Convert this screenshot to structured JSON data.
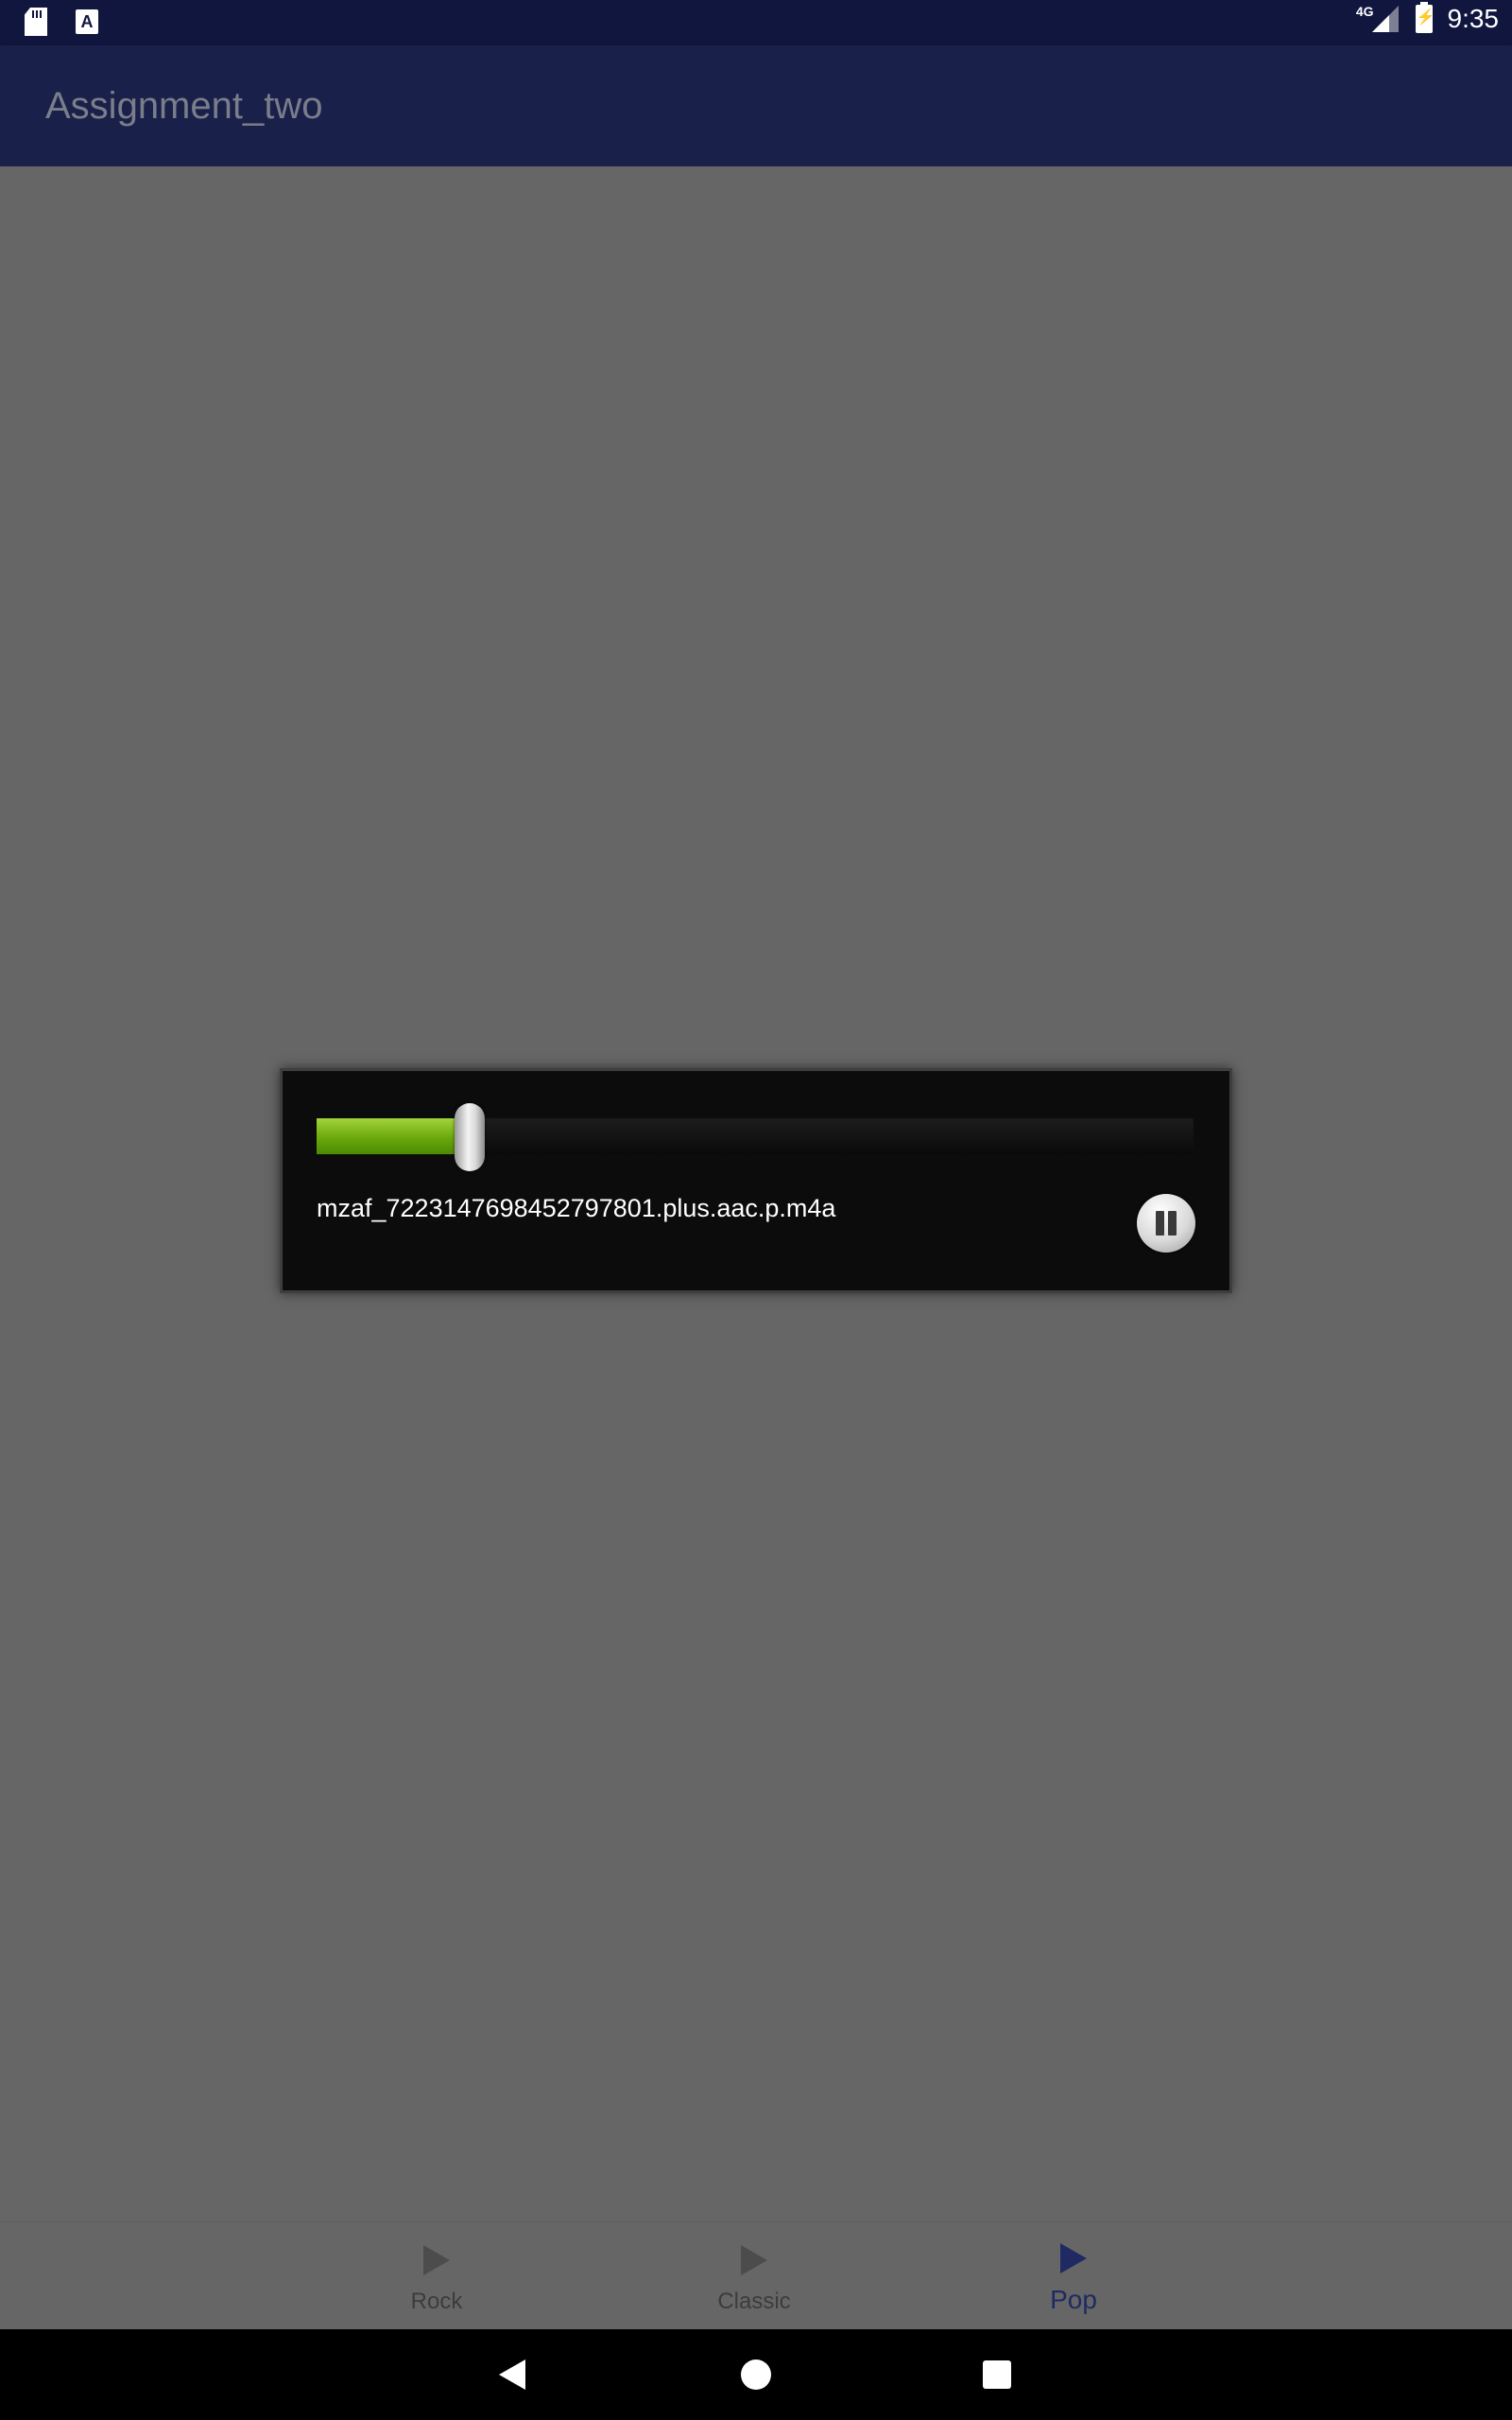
{
  "status_bar": {
    "network_type": "4G",
    "time": "9:35",
    "icons": [
      "sd-card-icon",
      "a-notification-icon",
      "signal-icon",
      "battery-charging-icon"
    ]
  },
  "app_bar": {
    "title": "Assignment_two"
  },
  "media_controller": {
    "track_name": "mzaf_7223147698452797801.plus.aac.p.m4a",
    "progress": 0.175,
    "play_state_icon": "pause-icon",
    "colors": {
      "progress_fill": "#6aa80c",
      "background": "#0c0c0c"
    }
  },
  "bottom_nav": {
    "items": [
      {
        "label": "Rock",
        "icon": "play-icon",
        "active": false
      },
      {
        "label": "Classic",
        "icon": "play-icon",
        "active": false
      },
      {
        "label": "Pop",
        "icon": "play-icon",
        "active": true
      }
    ],
    "active_color": "#1f2a63"
  },
  "system_nav": {
    "icons": [
      "back-icon",
      "home-icon",
      "recents-icon"
    ]
  }
}
